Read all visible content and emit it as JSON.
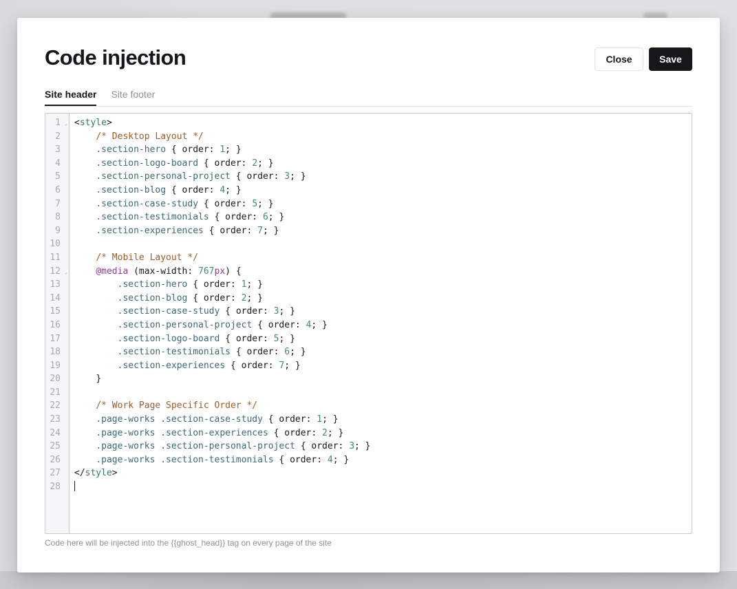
{
  "modal": {
    "title": "Code injection",
    "close_label": "Close",
    "save_label": "Save"
  },
  "tabs": [
    {
      "label": "Site header",
      "active": true
    },
    {
      "label": "Site footer",
      "active": false
    }
  ],
  "editor": {
    "fold_icon": "chevron-down-icon",
    "fold_lines": [
      1,
      12
    ],
    "lines": [
      [
        [
          "tag-br",
          "<"
        ],
        [
          "tag",
          "style"
        ],
        [
          "tag-br",
          ">"
        ]
      ],
      [
        [
          "ws",
          "    "
        ],
        [
          "cm",
          "/* Desktop Layout */"
        ]
      ],
      [
        [
          "ws",
          "    "
        ],
        [
          "sel",
          ".section-hero"
        ],
        [
          "p",
          " { order: "
        ],
        [
          "num",
          "1"
        ],
        [
          "p",
          "; }"
        ]
      ],
      [
        [
          "ws",
          "    "
        ],
        [
          "sel",
          ".section-logo-board"
        ],
        [
          "p",
          " { order: "
        ],
        [
          "num",
          "2"
        ],
        [
          "p",
          "; }"
        ]
      ],
      [
        [
          "ws",
          "    "
        ],
        [
          "sel",
          ".section-personal-project"
        ],
        [
          "p",
          " { order: "
        ],
        [
          "num",
          "3"
        ],
        [
          "p",
          "; }"
        ]
      ],
      [
        [
          "ws",
          "    "
        ],
        [
          "sel",
          ".section-blog"
        ],
        [
          "p",
          " { order: "
        ],
        [
          "num",
          "4"
        ],
        [
          "p",
          "; }"
        ]
      ],
      [
        [
          "ws",
          "    "
        ],
        [
          "sel",
          ".section-case-study"
        ],
        [
          "p",
          " { order: "
        ],
        [
          "num",
          "5"
        ],
        [
          "p",
          "; }"
        ]
      ],
      [
        [
          "ws",
          "    "
        ],
        [
          "sel",
          ".section-testimonials"
        ],
        [
          "p",
          " { order: "
        ],
        [
          "num",
          "6"
        ],
        [
          "p",
          "; }"
        ]
      ],
      [
        [
          "ws",
          "    "
        ],
        [
          "sel",
          ".section-experiences"
        ],
        [
          "p",
          " { order: "
        ],
        [
          "num",
          "7"
        ],
        [
          "p",
          "; }"
        ]
      ],
      [],
      [
        [
          "ws",
          "    "
        ],
        [
          "cm",
          "/* Mobile Layout */"
        ]
      ],
      [
        [
          "ws",
          "    "
        ],
        [
          "at",
          "@media"
        ],
        [
          "p",
          " (max-width: "
        ],
        [
          "num",
          "767"
        ],
        [
          "unit",
          "px"
        ],
        [
          "p",
          ") {"
        ]
      ],
      [
        [
          "ws",
          "        "
        ],
        [
          "sel",
          ".section-hero"
        ],
        [
          "p",
          " { order: "
        ],
        [
          "num",
          "1"
        ],
        [
          "p",
          "; }"
        ]
      ],
      [
        [
          "ws",
          "        "
        ],
        [
          "sel",
          ".section-blog"
        ],
        [
          "p",
          " { order: "
        ],
        [
          "num",
          "2"
        ],
        [
          "p",
          "; }"
        ]
      ],
      [
        [
          "ws",
          "        "
        ],
        [
          "sel",
          ".section-case-study"
        ],
        [
          "p",
          " { order: "
        ],
        [
          "num",
          "3"
        ],
        [
          "p",
          "; }"
        ]
      ],
      [
        [
          "ws",
          "        "
        ],
        [
          "sel",
          ".section-personal-project"
        ],
        [
          "p",
          " { order: "
        ],
        [
          "num",
          "4"
        ],
        [
          "p",
          "; }"
        ]
      ],
      [
        [
          "ws",
          "        "
        ],
        [
          "sel",
          ".section-logo-board"
        ],
        [
          "p",
          " { order: "
        ],
        [
          "num",
          "5"
        ],
        [
          "p",
          "; }"
        ]
      ],
      [
        [
          "ws",
          "        "
        ],
        [
          "sel",
          ".section-testimonials"
        ],
        [
          "p",
          " { order: "
        ],
        [
          "num",
          "6"
        ],
        [
          "p",
          "; }"
        ]
      ],
      [
        [
          "ws",
          "        "
        ],
        [
          "sel",
          ".section-experiences"
        ],
        [
          "p",
          " { order: "
        ],
        [
          "num",
          "7"
        ],
        [
          "p",
          "; }"
        ]
      ],
      [
        [
          "ws",
          "    "
        ],
        [
          "p",
          "}"
        ]
      ],
      [],
      [
        [
          "ws",
          "    "
        ],
        [
          "cm",
          "/* Work Page Specific Order */"
        ]
      ],
      [
        [
          "ws",
          "    "
        ],
        [
          "sel",
          ".page-works .section-case-study"
        ],
        [
          "p",
          " { order: "
        ],
        [
          "num",
          "1"
        ],
        [
          "p",
          "; }"
        ]
      ],
      [
        [
          "ws",
          "    "
        ],
        [
          "sel",
          ".page-works .section-experiences"
        ],
        [
          "p",
          " { order: "
        ],
        [
          "num",
          "2"
        ],
        [
          "p",
          "; }"
        ]
      ],
      [
        [
          "ws",
          "    "
        ],
        [
          "sel",
          ".page-works .section-personal-project"
        ],
        [
          "p",
          " { order: "
        ],
        [
          "num",
          "3"
        ],
        [
          "p",
          "; }"
        ]
      ],
      [
        [
          "ws",
          "    "
        ],
        [
          "sel",
          ".page-works .section-testimonials"
        ],
        [
          "p",
          " { order: "
        ],
        [
          "num",
          "4"
        ],
        [
          "p",
          "; }"
        ]
      ],
      [
        [
          "tag-br",
          "</"
        ],
        [
          "tag",
          "style"
        ],
        [
          "tag-br",
          ">"
        ]
      ],
      [
        [
          "cursor",
          ""
        ]
      ]
    ]
  },
  "hint": "Code here will be injected into the {{ghost_head}} tag on every page of the site"
}
